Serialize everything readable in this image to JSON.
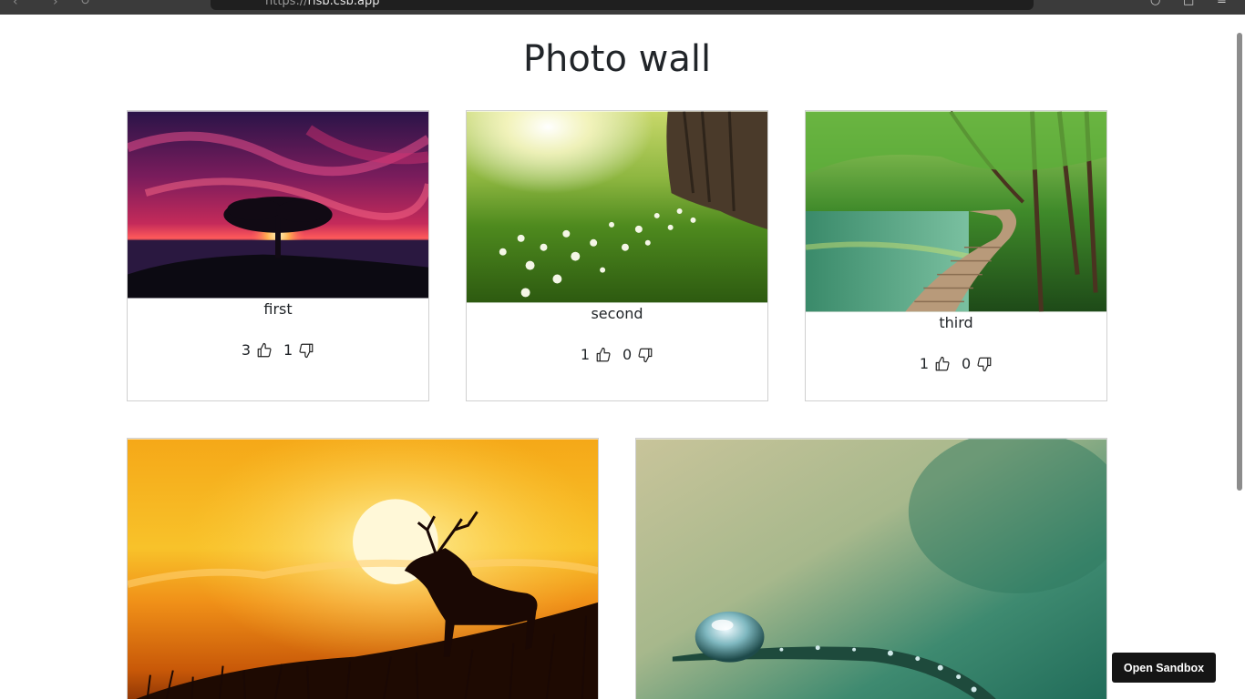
{
  "browser": {
    "url_prefix": "https://",
    "url_domain": "risb.csb.app"
  },
  "page": {
    "title": "Photo wall"
  },
  "photos": [
    {
      "caption": "first",
      "likes": "3",
      "dislikes": "1"
    },
    {
      "caption": "second",
      "likes": "1",
      "dislikes": "0"
    },
    {
      "caption": "third",
      "likes": "1",
      "dislikes": "0"
    },
    {
      "caption": "",
      "likes": "",
      "dislikes": ""
    },
    {
      "caption": "",
      "likes": "",
      "dislikes": ""
    }
  ],
  "sandbox_button": {
    "label": "Open Sandbox"
  },
  "icons": {
    "like": "thumbs-up-icon",
    "dislike": "thumbs-down-icon"
  }
}
